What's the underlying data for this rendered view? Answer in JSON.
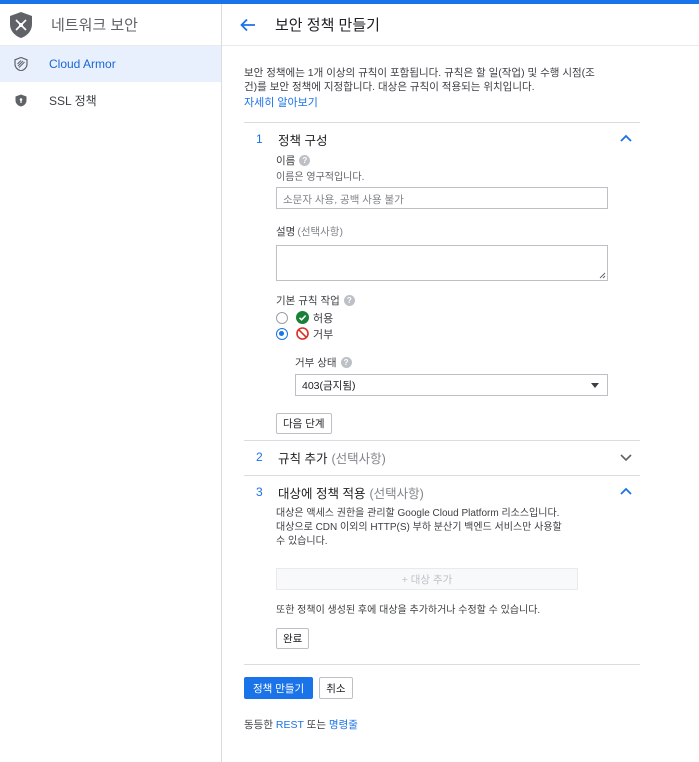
{
  "sidebar": {
    "title": "네트워크 보안",
    "items": [
      {
        "label": "Cloud Armor",
        "active": true
      },
      {
        "label": "SSL 정책",
        "active": false
      }
    ]
  },
  "header": {
    "title": "보안 정책 만들기"
  },
  "intro": {
    "line1": "보안 정책에는 1개 이상의 규칙이 포함됩니다. 규칙은 할 일(작업) 및 수행 시점(조",
    "line2": "건)를 보안 정책에 지정합니다. 대상은 규칙이 적용되는 위치입니다.",
    "learn_more": "자세히 알아보기"
  },
  "step1": {
    "number": "1",
    "title": "정책 구성",
    "name_label": "이름",
    "name_hint": "이름은 영구적입니다.",
    "name_placeholder": "소문자 사용, 공백 사용 불가",
    "desc_label": "설명",
    "desc_optional": "(선택사항)",
    "default_action_label": "기본 규칙 작업",
    "allow_label": "허용",
    "deny_label": "거부",
    "deny_status_label": "거부 상태",
    "deny_status_value": "403(금지됨)",
    "next_button": "다음 단계"
  },
  "step2": {
    "number": "2",
    "title": "규칙 추가",
    "optional": "(선택사항)"
  },
  "step3": {
    "number": "3",
    "title": "대상에 정책 적용",
    "optional": "(선택사항)",
    "desc1": "대상은 액세스 권한을 관리할 Google Cloud Platform 리소스입니다.",
    "desc2": "대상으로 CDN 이외의 HTTP(S) 부하 분산기 백엔드 서비스만 사용할",
    "desc3": "수 있습니다.",
    "add_target": "+ 대상 추가",
    "note": "또한 정책이 생성된 후에 대상을 추가하거나 수정할 수 있습니다.",
    "done_button": "완료"
  },
  "actions": {
    "create": "정책 만들기",
    "cancel": "취소"
  },
  "footer": {
    "prefix": "동등한",
    "rest": "REST",
    "or": "또는",
    "cli": "명령줄"
  },
  "colors": {
    "accent": "#1a73e8",
    "allow": "#188038",
    "deny": "#d93025"
  }
}
